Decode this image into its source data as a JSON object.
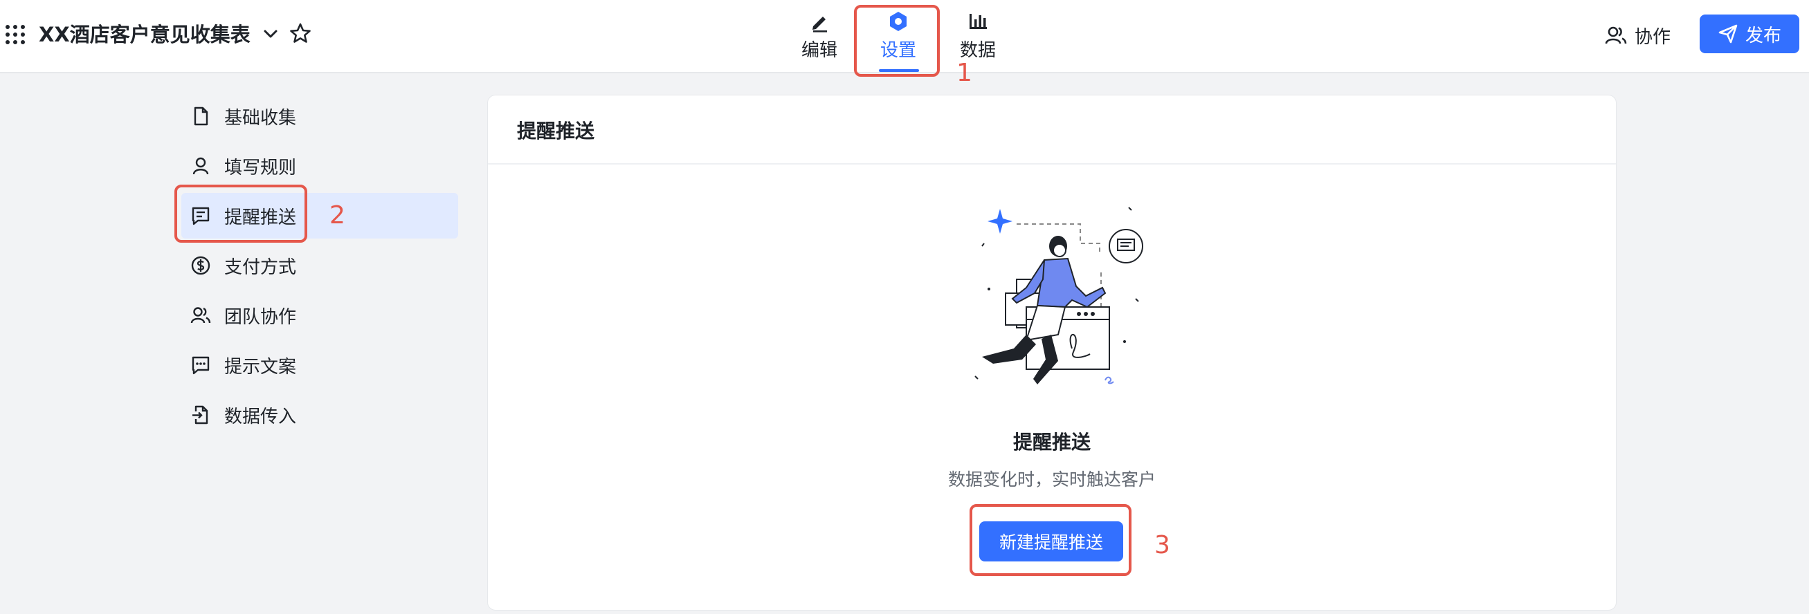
{
  "header": {
    "apps_icon": "grid-dots-icon",
    "title": "XX酒店客户意见收集表",
    "tabs": [
      {
        "label": "编辑",
        "icon": "pen-icon",
        "active": false
      },
      {
        "label": "设置",
        "icon": "hexagon-settings-icon",
        "active": true
      },
      {
        "label": "数据",
        "icon": "bar-chart-icon",
        "active": false
      }
    ],
    "collab_label": "协作",
    "publish_label": "发布"
  },
  "sidebar": {
    "items": [
      {
        "label": "基础收集",
        "icon": "file-icon",
        "active": false
      },
      {
        "label": "填写规则",
        "icon": "user-icon",
        "active": false
      },
      {
        "label": "提醒推送",
        "icon": "message-icon",
        "active": true
      },
      {
        "label": "支付方式",
        "icon": "dollar-icon",
        "active": false
      },
      {
        "label": "团队协作",
        "icon": "team-icon",
        "active": false
      },
      {
        "label": "提示文案",
        "icon": "comment-dots-icon",
        "active": false
      },
      {
        "label": "数据传入",
        "icon": "import-icon",
        "active": false
      }
    ]
  },
  "main": {
    "card_title": "提醒推送",
    "empty_title": "提醒推送",
    "empty_desc": "数据变化时，实时触达客户",
    "new_button_label": "新建提醒推送"
  },
  "annotations": [
    "1",
    "2",
    "3"
  ],
  "colors": {
    "accent": "#3370ff",
    "annotation": "#e5574b",
    "active_bg": "#e1eaff",
    "page_bg": "#f2f3f5"
  }
}
